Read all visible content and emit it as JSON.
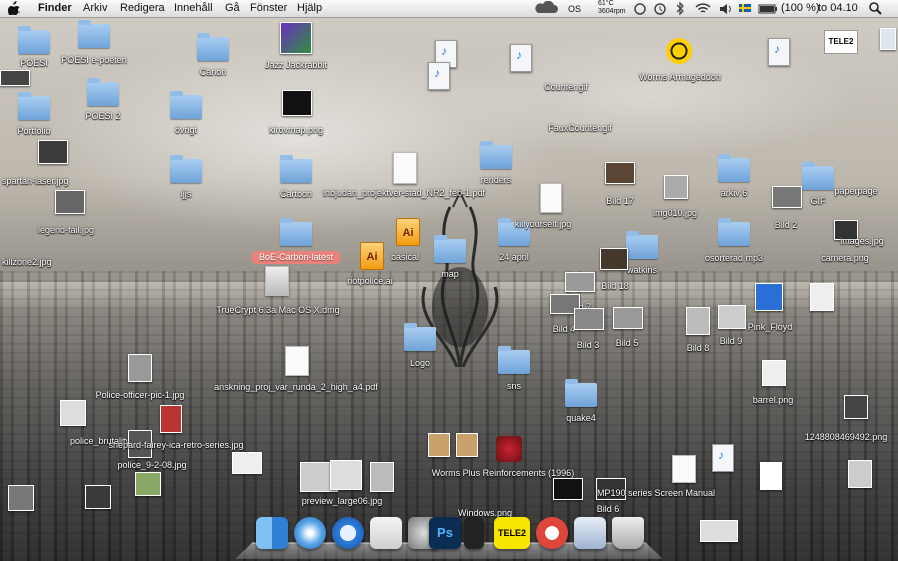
{
  "menubar": {
    "app_name": "Finder",
    "menus": [
      "Arkiv",
      "Redigera",
      "Innehåll",
      "Gå",
      "Fönster",
      "Hjälp"
    ],
    "os_label": "OS",
    "weather_temp": "61°C",
    "weather_sub": "3604rpm",
    "battery": "(100 %)",
    "clock": "to 04.10"
  },
  "desktop": {
    "folders": [
      {
        "label": "POESI"
      },
      {
        "label": "POESI e-poeten"
      },
      {
        "label": "Canon"
      },
      {
        "label": "Portfolio"
      },
      {
        "label": "POESI 2"
      },
      {
        "label": "övrigt"
      },
      {
        "label": "ljjs"
      },
      {
        "label": "Cartoon"
      },
      {
        "label": "renders"
      },
      {
        "label": "basical"
      },
      {
        "label": "map"
      },
      {
        "label": "24 april"
      },
      {
        "label": "Logo"
      },
      {
        "label": "sns"
      },
      {
        "label": "quake4"
      },
      {
        "label": "arkiv 6"
      },
      {
        "label": "watkins"
      },
      {
        "label": "osorterad mp3"
      },
      {
        "label": "GIF"
      }
    ],
    "files": [
      {
        "label": "Jazz Jackrabbit"
      },
      {
        "label": "kirovmap.png"
      },
      {
        "label": "inbjudan_projektver-stad_NR2_feb-1.pdf"
      },
      {
        "label": "riotpolice.ai"
      },
      {
        "label": "TrueCrypt 6.3a Mac OS X.dmg"
      },
      {
        "label": "anskning_proj_var_runda_2_high_a4.pdf"
      },
      {
        "label": "killyourself.jpg"
      },
      {
        "label": "Bild 17"
      },
      {
        "label": "Bild 18"
      },
      {
        "label": "Bild 7"
      },
      {
        "label": "Bild 4"
      },
      {
        "label": "Bild 3"
      },
      {
        "label": "Bild 5"
      },
      {
        "label": "Bild 8"
      },
      {
        "label": "Bild 9"
      },
      {
        "label": "Bild 2"
      },
      {
        "label": "Bild 6"
      },
      {
        "label": "img010.jpg"
      },
      {
        "label": "FauxCounter.gif"
      },
      {
        "label": "Counter.gif"
      },
      {
        "label": "Worms Armageddon"
      },
      {
        "label": "camera.png"
      },
      {
        "label": "images.jpg"
      },
      {
        "label": "Pink_Floyd"
      },
      {
        "label": "barrel.png"
      },
      {
        "label": "Worms Plus Reinforcements (1996)"
      },
      {
        "label": "Windows.png"
      },
      {
        "label": "police_brutality"
      },
      {
        "label": "police_9-2-08.jpg"
      },
      {
        "label": "spartan-laser.jpg"
      },
      {
        "label": "legend-fail.jpg"
      },
      {
        "label": "killzone2.jpg"
      },
      {
        "label": "MP190 series Screen Manual"
      },
      {
        "label": "preview_large06.jpg"
      },
      {
        "label": "shepard-fairey-ica-retro-series.jpg"
      },
      {
        "label": "Police-officer-pic-1.jpg"
      },
      {
        "label": "TELE2"
      },
      {
        "label": "paperpage"
      },
      {
        "label": "1248808469492.png"
      }
    ],
    "badge_label": "BoE-Carbon-latest"
  },
  "dock": {
    "items": [
      "Finder",
      "Safari",
      "iTunes",
      "Preview",
      "Photoshop",
      "TELE2",
      "Mail",
      "Downloads",
      "Trash"
    ]
  },
  "colors": {
    "folder": "#7fb0e0",
    "badge": "#e9827a",
    "ai": "#f39c12"
  }
}
